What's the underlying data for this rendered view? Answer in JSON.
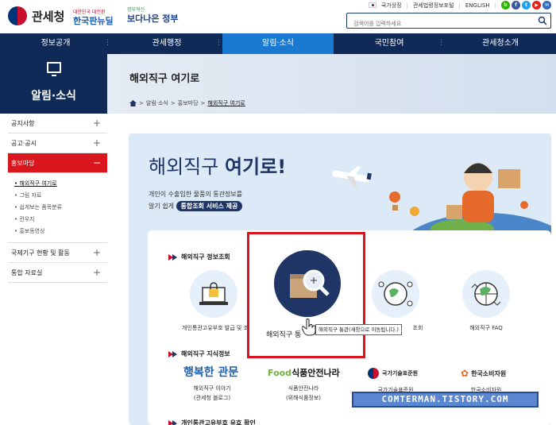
{
  "header": {
    "logo_text": "관세청",
    "brand1_small": "대한민국 대전환",
    "brand1": "한국판뉴딜",
    "brand2_small": "정부혁신",
    "brand2": "보다나은 정부",
    "util": {
      "national_symbol": "국가상징",
      "law_portal": "관세법령정보포털",
      "english": "ENGLISH"
    },
    "search": {
      "placeholder": "검색어를 입력하세요"
    },
    "colors": {
      "navy": "#0f2a56",
      "accent": "#1a7ad1",
      "red": "#d9161d"
    }
  },
  "nav": {
    "items": [
      {
        "label": "정보공개"
      },
      {
        "label": "관세행정"
      },
      {
        "label": "알림·소식"
      },
      {
        "label": "국민참여"
      },
      {
        "label": "관세청소개"
      }
    ],
    "active_index": 2
  },
  "sidebar": {
    "title": "알림·소식",
    "icon": "monitor-icon",
    "items": [
      {
        "label": "공지사항"
      },
      {
        "label": "공고·공시"
      },
      {
        "label": "홍보마당"
      },
      {
        "label": "국제기구 현황 및 활동"
      },
      {
        "label": "통합 자료실"
      }
    ],
    "sub_items": [
      {
        "label": "해외직구 여기로"
      },
      {
        "label": "그림 자료"
      },
      {
        "label": "쉽게보는 품목분류"
      },
      {
        "label": "관우지"
      },
      {
        "label": "홍보동영상"
      }
    ]
  },
  "page": {
    "title": "해외직구 여기로",
    "breadcrumb": [
      "알림·소식",
      "홍보마당",
      "해외직구 여기로"
    ]
  },
  "hero": {
    "title_a": "해외직구 ",
    "title_b": "여기로!",
    "desc1": "개인이 수출입한 물품의 통관정보를",
    "desc2": "알기 쉽게",
    "tag": "통합조회 서비스 제공"
  },
  "sections": {
    "info": "해외직구 정보조회",
    "knowledge": "해외직구 지식정보",
    "third": "개인통관고유부호 유효 확인"
  },
  "info_items": [
    {
      "label": "개인통관고유부호 발급 및 조",
      "icon": "lock-laptop-icon"
    },
    {
      "label": "해외직구 통",
      "icon": "package-search-icon"
    },
    {
      "label": "조회",
      "icon": "globe-network-icon"
    },
    {
      "label": "해외직구 FAQ",
      "icon": "globe-arrows-icon"
    }
  ],
  "tooltip": "해외직구 통관(새창으로 이동됩니다.)",
  "knowledge_items": [
    {
      "logo": "행복한 관문",
      "line1": "해외직구 이야기",
      "line2": "(관세청 블로그)"
    },
    {
      "logo": "식품안전나라",
      "line1": "식품안전나라",
      "line2": "(위해식품정보)"
    },
    {
      "logo": "국가기술표준원",
      "line1": "국가기술표준원",
      "line2": ""
    },
    {
      "logo": "한국소비자원",
      "line1": "한국소비자원",
      "line2": ""
    }
  ],
  "watermark": "COMTERMAN.TISTORY.COM"
}
